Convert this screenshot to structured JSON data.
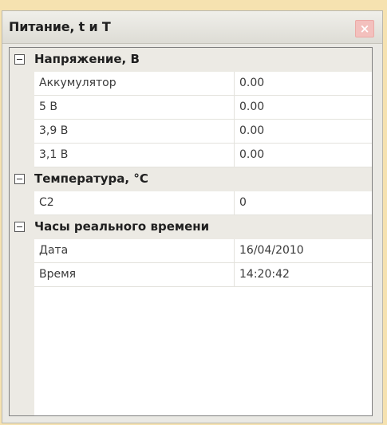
{
  "window": {
    "title": "Питание, t и T",
    "close_label": "×"
  },
  "grid": {
    "categories": [
      {
        "label": "Напряжение, В",
        "rows": [
          {
            "name": "Аккумулятор",
            "value": "0.00"
          },
          {
            "name": "5 В",
            "value": "0.00"
          },
          {
            "name": "3,9 В",
            "value": "0.00"
          },
          {
            "name": "3,1 В",
            "value": "0.00"
          }
        ]
      },
      {
        "label": "Температура, °C",
        "rows": [
          {
            "name": "C2",
            "value": "0"
          }
        ]
      },
      {
        "label": "Часы реального времени",
        "rows": [
          {
            "name": "Дата",
            "value": "16/04/2010"
          },
          {
            "name": "Время",
            "value": "14:20:42"
          }
        ]
      }
    ]
  },
  "colors": {
    "background": "#f6e2b0",
    "panel": "#eae9e4",
    "close_button": "#f3c0bd"
  }
}
